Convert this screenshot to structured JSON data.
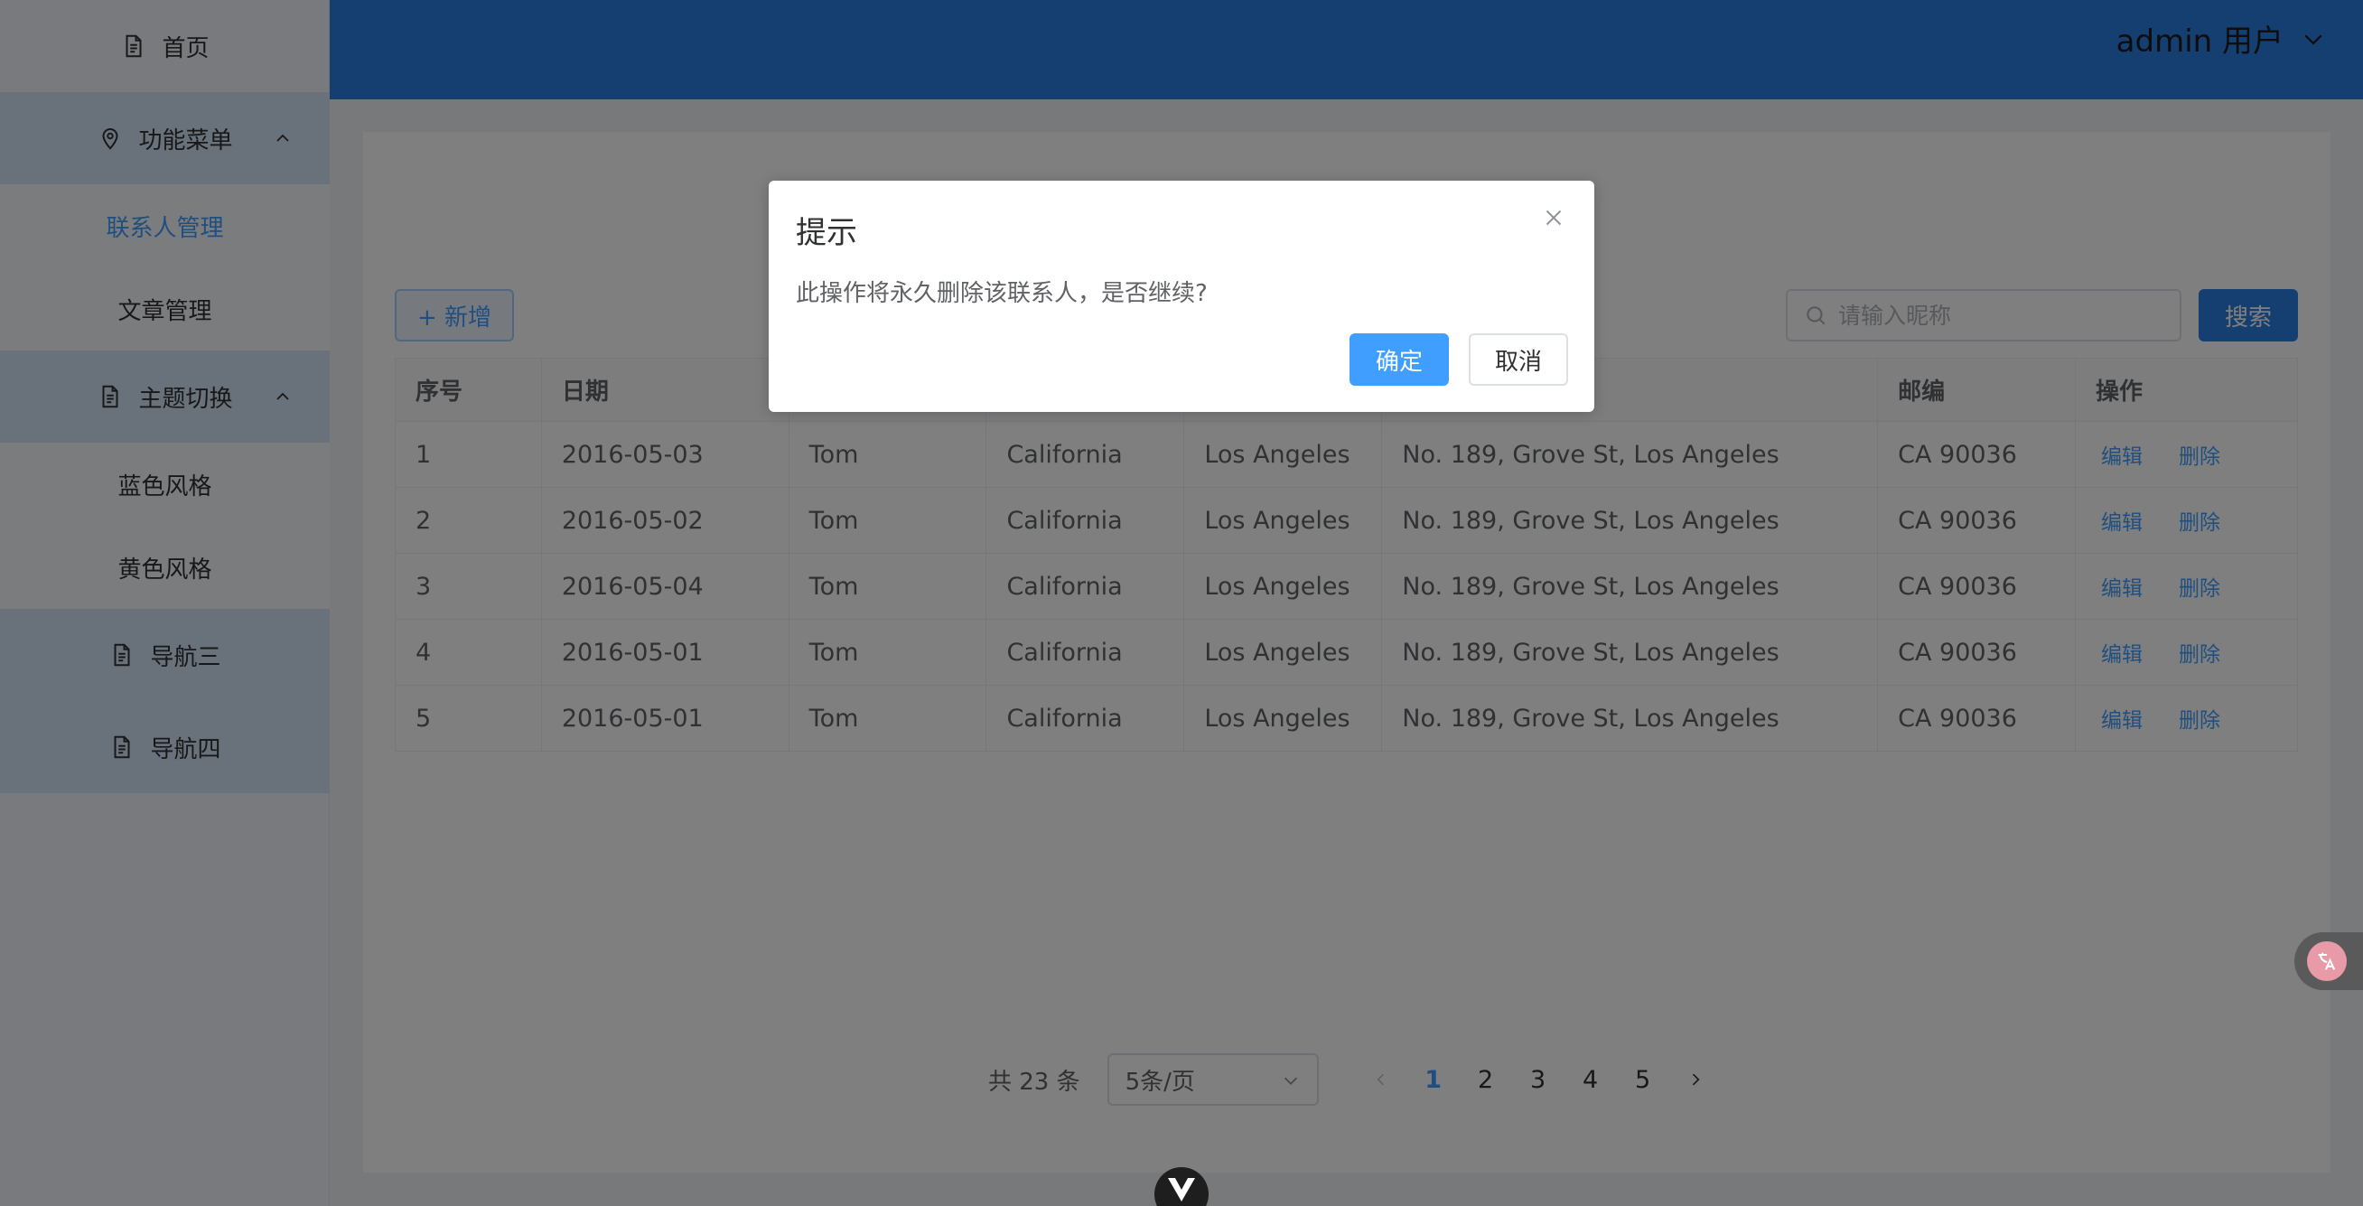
{
  "sidebar": {
    "home": {
      "label": "首页",
      "icon": "document-icon"
    },
    "menu_functions": {
      "label": "功能菜单",
      "icon": "location-pin-icon"
    },
    "contacts": {
      "label": "联系人管理"
    },
    "articles": {
      "label": "文章管理"
    },
    "menu_theme": {
      "label": "主题切换",
      "icon": "document-icon"
    },
    "theme_blue": {
      "label": "蓝色风格"
    },
    "theme_yellow": {
      "label": "黄色风格"
    },
    "nav3": {
      "label": "导航三",
      "icon": "document-icon"
    },
    "nav4": {
      "label": "导航四",
      "icon": "document-icon"
    }
  },
  "header": {
    "user_label": "admin 用户"
  },
  "toolbar": {
    "add_label": "+ 新增",
    "search_placeholder": "请输入昵称",
    "search_label": "搜索"
  },
  "table": {
    "headers": [
      "序号",
      "日期",
      "",
      "",
      "",
      "",
      "邮编",
      "操作"
    ],
    "rows": [
      {
        "id": "1",
        "date": "2016-05-03",
        "name": "Tom",
        "state": "California",
        "city": "Los Angeles",
        "address": "No. 189, Grove St, Los Angeles",
        "zip": "CA 90036"
      },
      {
        "id": "2",
        "date": "2016-05-02",
        "name": "Tom",
        "state": "California",
        "city": "Los Angeles",
        "address": "No. 189, Grove St, Los Angeles",
        "zip": "CA 90036"
      },
      {
        "id": "3",
        "date": "2016-05-04",
        "name": "Tom",
        "state": "California",
        "city": "Los Angeles",
        "address": "No. 189, Grove St, Los Angeles",
        "zip": "CA 90036"
      },
      {
        "id": "4",
        "date": "2016-05-01",
        "name": "Tom",
        "state": "California",
        "city": "Los Angeles",
        "address": "No. 189, Grove St, Los Angeles",
        "zip": "CA 90036"
      },
      {
        "id": "5",
        "date": "2016-05-01",
        "name": "Tom",
        "state": "California",
        "city": "Los Angeles",
        "address": "No. 189, Grove St, Los Angeles",
        "zip": "CA 90036"
      }
    ],
    "edit_label": "编辑",
    "delete_label": "删除"
  },
  "pagination": {
    "total": "共 23 条",
    "page_size": "5条/页",
    "pages": [
      "1",
      "2",
      "3",
      "4",
      "5"
    ],
    "current": "1"
  },
  "dialog": {
    "title": "提示",
    "message": "此操作将永久删除该联系人，是否继续?",
    "confirm_label": "确定",
    "cancel_label": "取消"
  },
  "colors": {
    "primary": "#409eff",
    "header": "#2d7fe3",
    "sidebar_group": "#d2e4f7"
  }
}
